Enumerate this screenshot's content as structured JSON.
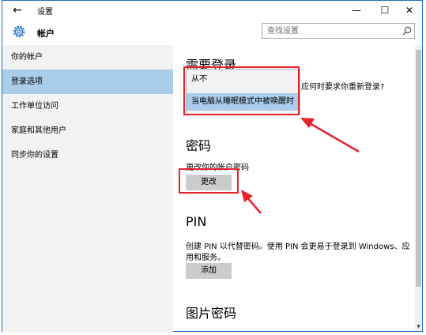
{
  "window": {
    "title": "设置",
    "back_icon": "←",
    "minimize_icon": "—",
    "maximize_icon": "☐",
    "close_icon": "✕"
  },
  "header": {
    "title": "帐户",
    "icon": "gear-icon",
    "search_placeholder": "查找设置"
  },
  "sidebar": {
    "items": [
      {
        "label": "你的帐户",
        "active": false
      },
      {
        "label": "登录选项",
        "active": true
      },
      {
        "label": "工作单位访问",
        "active": false
      },
      {
        "label": "家庭和其他用户",
        "active": false
      },
      {
        "label": "同步你的设置",
        "active": false
      }
    ]
  },
  "main": {
    "sign_in": {
      "heading": "需要登录",
      "question": "应何时要求你重新登录?",
      "dropdown_options": [
        "从不",
        "当电脑从睡眠模式中被唤醒时"
      ],
      "selected_index": 1
    },
    "password": {
      "heading": "密码",
      "description": "更改你的帐户密码",
      "button": "更改"
    },
    "pin": {
      "heading": "PIN",
      "description_line1": "创建 PIN 以代替密码。使用 PIN 会更易于登录到 Windows、应",
      "description_line2": "用和服务。",
      "button": "添加"
    },
    "picture_password": {
      "heading": "图片密码"
    }
  },
  "colors": {
    "accent": "#a9cdea",
    "highlight_red": "#e8222a",
    "sidebar_bg": "#f2f2f2",
    "button_bg": "#cccccc"
  }
}
